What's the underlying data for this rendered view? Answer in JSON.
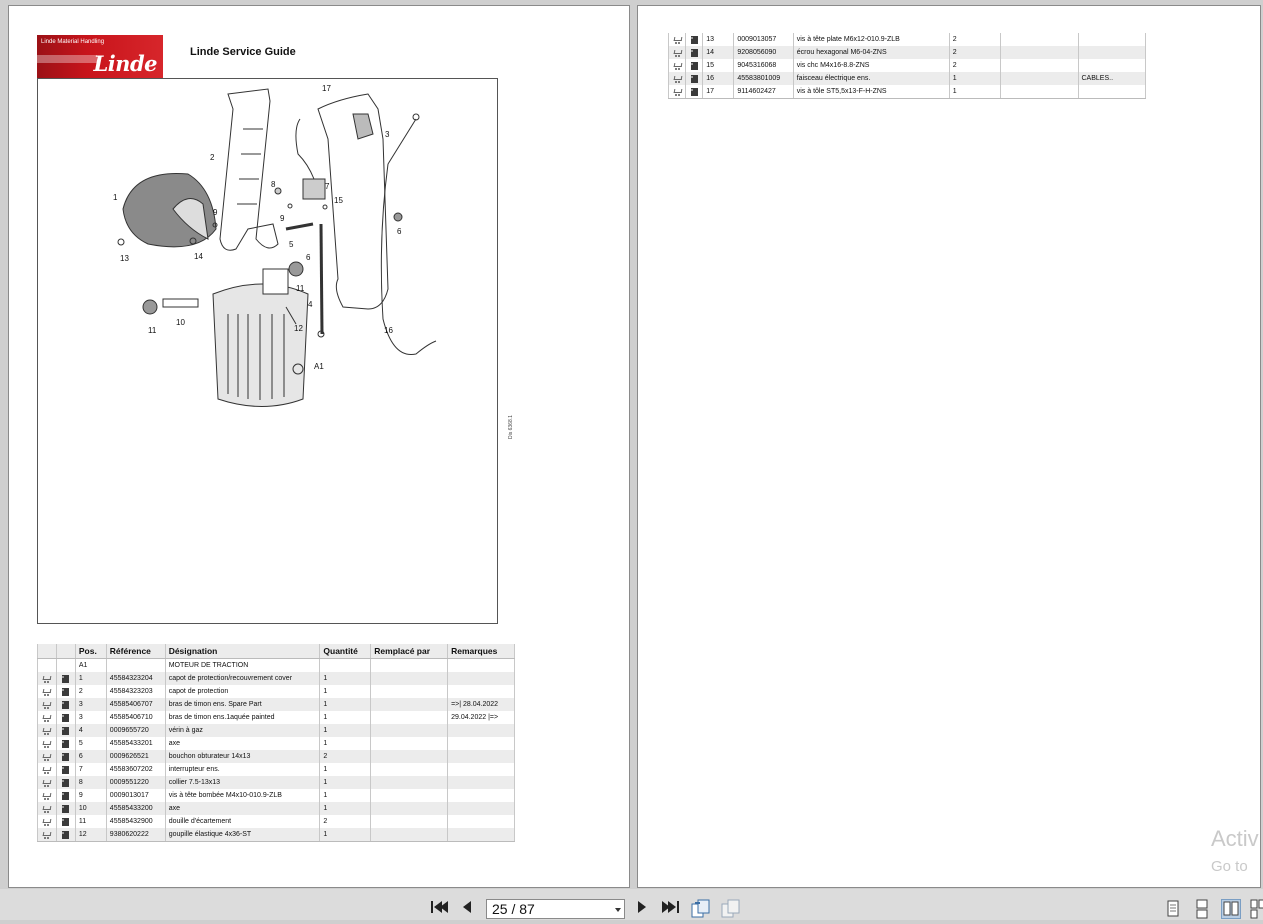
{
  "document": {
    "brand": "Linde",
    "brand_subtitle": "Linde Material Handling",
    "title": "Linde Service Guide",
    "drawing_code": "Dis 6368.1"
  },
  "diagram": {
    "callouts": [
      "1",
      "2",
      "3",
      "4",
      "5",
      "6",
      "6",
      "7",
      "8",
      "9",
      "9",
      "10",
      "11",
      "11",
      "12",
      "13",
      "14",
      "15",
      "16",
      "17",
      "A1"
    ]
  },
  "parts_table": {
    "columns": [
      "",
      "",
      "Pos.",
      "Référence",
      "Désignation",
      "Quantité",
      "Remplacé par",
      "Remarques"
    ],
    "rows_left": [
      {
        "pos": "A1",
        "ref": "",
        "desc": "MOTEUR DE TRACTION",
        "qty": "",
        "repl": "",
        "rem": "",
        "icons": false
      },
      {
        "pos": "1",
        "ref": "45584323204",
        "desc": "capot de protection/recouvrement cover",
        "qty": "1",
        "repl": "",
        "rem": "",
        "icons": true
      },
      {
        "pos": "2",
        "ref": "45584323203",
        "desc": "capot de protection",
        "qty": "1",
        "repl": "",
        "rem": "",
        "icons": true
      },
      {
        "pos": "3",
        "ref": "45585406707",
        "desc": "bras de timon ens. Spare Part",
        "qty": "1",
        "repl": "",
        "rem": "=>| 28.04.2022",
        "icons": true
      },
      {
        "pos": "3",
        "ref": "45585406710",
        "desc": "bras de timon ens.1aquée painted",
        "qty": "1",
        "repl": "",
        "rem": "29.04.2022 |=>",
        "icons": true
      },
      {
        "pos": "4",
        "ref": "0009655720",
        "desc": "vérin à gaz",
        "qty": "1",
        "repl": "",
        "rem": "",
        "icons": true
      },
      {
        "pos": "5",
        "ref": "45585433201",
        "desc": "axe",
        "qty": "1",
        "repl": "",
        "rem": "",
        "icons": true
      },
      {
        "pos": "6",
        "ref": "0009626521",
        "desc": "bouchon obturateur 14x13",
        "qty": "2",
        "repl": "",
        "rem": "",
        "icons": true
      },
      {
        "pos": "7",
        "ref": "45583607202",
        "desc": "interrupteur ens.",
        "qty": "1",
        "repl": "",
        "rem": "",
        "icons": true
      },
      {
        "pos": "8",
        "ref": "0009551220",
        "desc": "collier 7.5-13x13",
        "qty": "1",
        "repl": "",
        "rem": "",
        "icons": true
      },
      {
        "pos": "9",
        "ref": "0009013017",
        "desc": "vis à tête bombée M4x10-010.9-ZLB",
        "qty": "1",
        "repl": "",
        "rem": "",
        "icons": true
      },
      {
        "pos": "10",
        "ref": "45585433200",
        "desc": "axe",
        "qty": "1",
        "repl": "",
        "rem": "",
        "icons": true
      },
      {
        "pos": "11",
        "ref": "45585432900",
        "desc": "douille d'écartement",
        "qty": "2",
        "repl": "",
        "rem": "",
        "icons": true
      },
      {
        "pos": "12",
        "ref": "9380620222",
        "desc": "goupille élastique 4x36-ST",
        "qty": "1",
        "repl": "",
        "rem": "",
        "icons": true
      }
    ],
    "rows_right": [
      {
        "pos": "13",
        "ref": "0009013057",
        "desc": "vis à tête plate M6x12-010.9-ZLB",
        "qty": "2",
        "repl": "",
        "rem": "",
        "icons": true
      },
      {
        "pos": "14",
        "ref": "9208056090",
        "desc": "écrou hexagonal M6-04-ZNS",
        "qty": "2",
        "repl": "",
        "rem": "",
        "icons": true
      },
      {
        "pos": "15",
        "ref": "9045316068",
        "desc": "vis chc M4x16-8.8-ZNS",
        "qty": "2",
        "repl": "",
        "rem": "",
        "icons": true
      },
      {
        "pos": "16",
        "ref": "45583801009",
        "desc": "faisceau électrique ens.",
        "qty": "1",
        "repl": "",
        "rem": "CABLES..",
        "icons": true
      },
      {
        "pos": "17",
        "ref": "9114602427",
        "desc": "vis à tôle ST5,5x13-F-H-ZNS",
        "qty": "1",
        "repl": "",
        "rem": "",
        "icons": true
      }
    ]
  },
  "watermark": {
    "line1": "Activ",
    "line2": "Go to"
  },
  "toolbar": {
    "page_indicator": "25 / 87",
    "icons": [
      "first-page-icon",
      "previous-page-icon",
      "next-page-icon",
      "last-page-icon",
      "previous-view-icon",
      "next-view-icon",
      "single-page-icon",
      "continuous-page-icon",
      "facing-pages-icon",
      "continuous-facing-icon"
    ]
  }
}
